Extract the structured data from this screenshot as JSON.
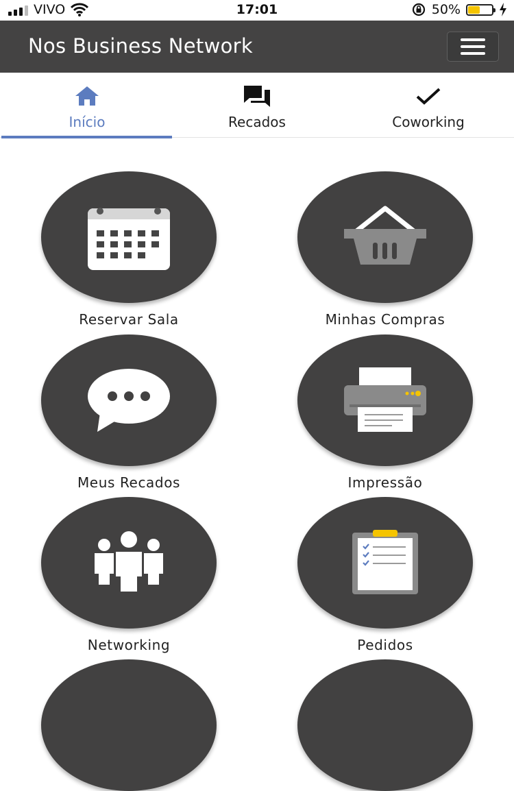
{
  "status_bar": {
    "carrier": "VIVO",
    "time": "17:01",
    "battery_percent": "50%",
    "battery_level": 0.5
  },
  "header": {
    "title": "Nos Business Network",
    "menu_icon": "hamburger-menu-icon"
  },
  "tabs": [
    {
      "label": "Início",
      "icon": "home-icon",
      "active": true
    },
    {
      "label": "Recados",
      "icon": "chat-bubbles-icon",
      "active": false
    },
    {
      "label": "Coworking",
      "icon": "checkmark-icon",
      "active": false
    }
  ],
  "tiles": [
    {
      "label": "Reservar Sala",
      "icon": "calendar-icon"
    },
    {
      "label": "Minhas Compras",
      "icon": "shopping-basket-icon"
    },
    {
      "label": "Meus Recados",
      "icon": "speech-bubble-icon"
    },
    {
      "label": "Impressão",
      "icon": "printer-icon"
    },
    {
      "label": "Networking",
      "icon": "people-icon"
    },
    {
      "label": "Pedidos",
      "icon": "clipboard-checklist-icon"
    }
  ],
  "colors": {
    "header_bg": "#444343",
    "accent": "#5c7cbf",
    "tile_bg": "#424141",
    "battery": "#f5c400"
  }
}
